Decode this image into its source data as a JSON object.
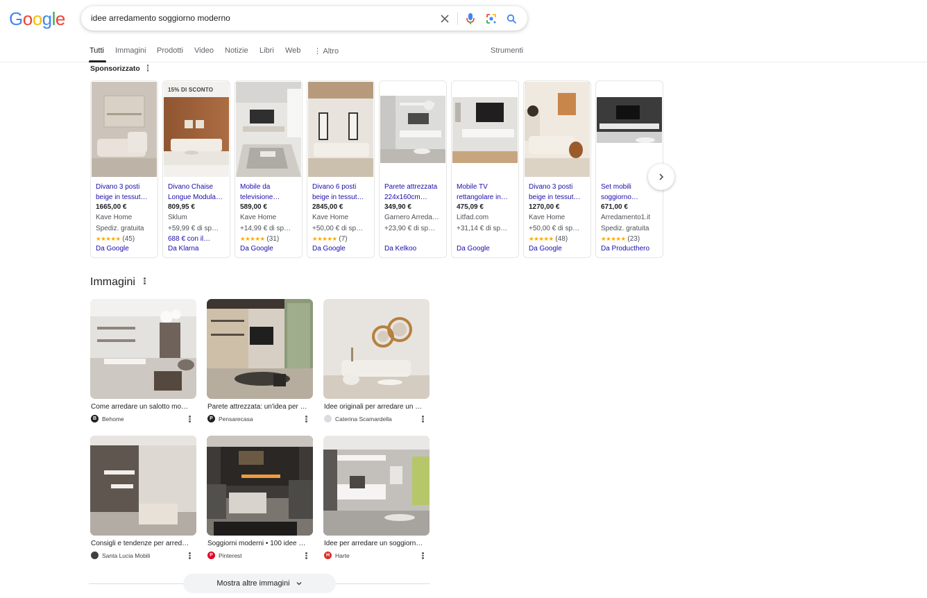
{
  "logo": {
    "text": "Google",
    "letters": [
      "G",
      "o",
      "o",
      "g",
      "l",
      "e"
    ],
    "colors": [
      "#4285F4",
      "#EA4335",
      "#FBBC05",
      "#4285F4",
      "#34A853",
      "#EA4335"
    ]
  },
  "search": {
    "query": "idee arredamento soggiorno moderno"
  },
  "tabs": [
    "Tutti",
    "Immagini",
    "Prodotti",
    "Video",
    "Notizie",
    "Libri",
    "Web",
    "Altro"
  ],
  "tools_label": "Strumenti",
  "sponsored": {
    "title": "Sponsorizzato",
    "products": [
      {
        "name": "Divano 3 posti beige in tessut…",
        "price": "1665,00 €",
        "shop": "Kave Home",
        "shipping": "Spediz. gratuita",
        "stars": "★★★★★",
        "reviews": "(45)",
        "source": "Da Google"
      },
      {
        "badge": "15% DI SCONTO",
        "name": "Divano Chaise Longue Modula…",
        "price": "809,95 €",
        "shop": "Sklum",
        "shipping": "+59,99 € di sp…",
        "extra": "688 € con il…",
        "source": "Da Klarna"
      },
      {
        "name": "Mobile da televisione…",
        "price": "589,00 €",
        "shop": "Kave Home",
        "shipping": "+14,99 € di sp…",
        "stars": "★★★★★",
        "reviews": "(31)",
        "source": "Da Google"
      },
      {
        "name": "Divano 6 posti beige in tessut…",
        "price": "2845,00 €",
        "shop": "Kave Home",
        "shipping": "+50,00 € di sp…",
        "stars": "★★★★★",
        "reviews": "(7)",
        "source": "Da Google"
      },
      {
        "name": "Parete attrezzata 224x160cm…",
        "price": "349,90 €",
        "shop": "Garnero Arreda…",
        "shipping": "+23,90 € di sp…",
        "source": "Da Kelkoo"
      },
      {
        "name": "Mobile TV rettangolare in…",
        "price": "475,09 €",
        "shop": "Litfad.com",
        "shipping": "+31,14 € di sp…",
        "source": "Da Google"
      },
      {
        "name": "Divano 3 posti beige in tessut…",
        "price": "1270,00 €",
        "shop": "Kave Home",
        "shipping": "+50,00 € di sp…",
        "stars": "★★★★★",
        "reviews": "(48)",
        "source": "Da Google"
      },
      {
        "name": "Set mobili soggiorno…",
        "price": "671,00 €",
        "shop": "Arredamento1.it",
        "shipping": "Spediz. gratuita",
        "stars": "★★★★★",
        "reviews": "(23)",
        "source": "Da Producthero"
      }
    ]
  },
  "images": {
    "title": "Immagini",
    "items": [
      {
        "caption": "Come arredare un salotto mo…",
        "source": "Behome",
        "favicon": "B",
        "favicon_color": "#202124"
      },
      {
        "caption": "Parete attrezzata: un'idea per …",
        "source": "Pensarecasa",
        "favicon": "P",
        "favicon_color": "#202124"
      },
      {
        "caption": "Idee originali per arredare un …",
        "source": "Caterina Scamardella",
        "favicon": "",
        "favicon_color": "#dadce0"
      },
      {
        "caption": "Consigli e tendenze per arred…",
        "source": "Santa Lucia Mobili",
        "favicon": "",
        "favicon_color": "#3c4043"
      },
      {
        "caption": "Soggiorni moderni • 100 idee …",
        "source": "Pinterest",
        "favicon": "P",
        "favicon_color": "#e60023"
      },
      {
        "caption": "Idee per arredare un soggiorn…",
        "source": "Harte",
        "favicon": "H",
        "favicon_color": "#d93025"
      }
    ],
    "more_label": "Mostra altre immagini"
  }
}
